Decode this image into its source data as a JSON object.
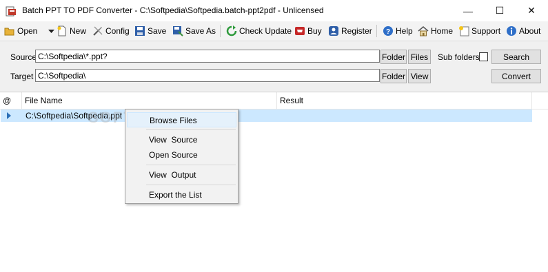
{
  "window": {
    "title": "Batch PPT TO PDF Converter - C:\\Softpedia\\Softpedia.batch-ppt2pdf - Unlicensed",
    "minimize": "—",
    "maximize": "☐",
    "close": "✕"
  },
  "toolbar": {
    "open": "Open",
    "new": "New",
    "config": "Config",
    "save": "Save",
    "save_as": "Save As",
    "check_update": "Check Update",
    "buy": "Buy",
    "register": "Register",
    "help": "Help",
    "home": "Home",
    "support": "Support",
    "about": "About"
  },
  "source": {
    "label": "Source",
    "value": "C:\\Softpedia\\*.ppt?",
    "folder_btn": "Folder",
    "files_btn": "Files",
    "subfolders_label": "Sub folders",
    "search_btn": "Search"
  },
  "target": {
    "label": "Target",
    "value": "C:\\Softpedia\\",
    "folder_btn": "Folder",
    "view_btn": "View",
    "convert_btn": "Convert"
  },
  "grid": {
    "columns": [
      "@",
      "File Name",
      "Result"
    ],
    "rows": [
      {
        "file": "C:\\Softpedia\\Softpedia.ppt",
        "result": ""
      }
    ]
  },
  "context_menu": {
    "items": [
      "Browse Files",
      "View  Source",
      "Open Source",
      "View  Output",
      "Export the List"
    ]
  },
  "watermark": "SOFTPEDIA",
  "icons": {
    "app": "app-ppt-icon",
    "open": "folder-open-icon",
    "new": "new-document-icon",
    "config": "tools-icon",
    "save": "floppy-icon",
    "save_as": "floppy-save-as-icon",
    "check_update": "refresh-icon",
    "buy": "cart-icon",
    "register": "user-icon",
    "help": "help-icon",
    "home": "home-icon",
    "support": "support-icon",
    "about": "info-icon"
  }
}
